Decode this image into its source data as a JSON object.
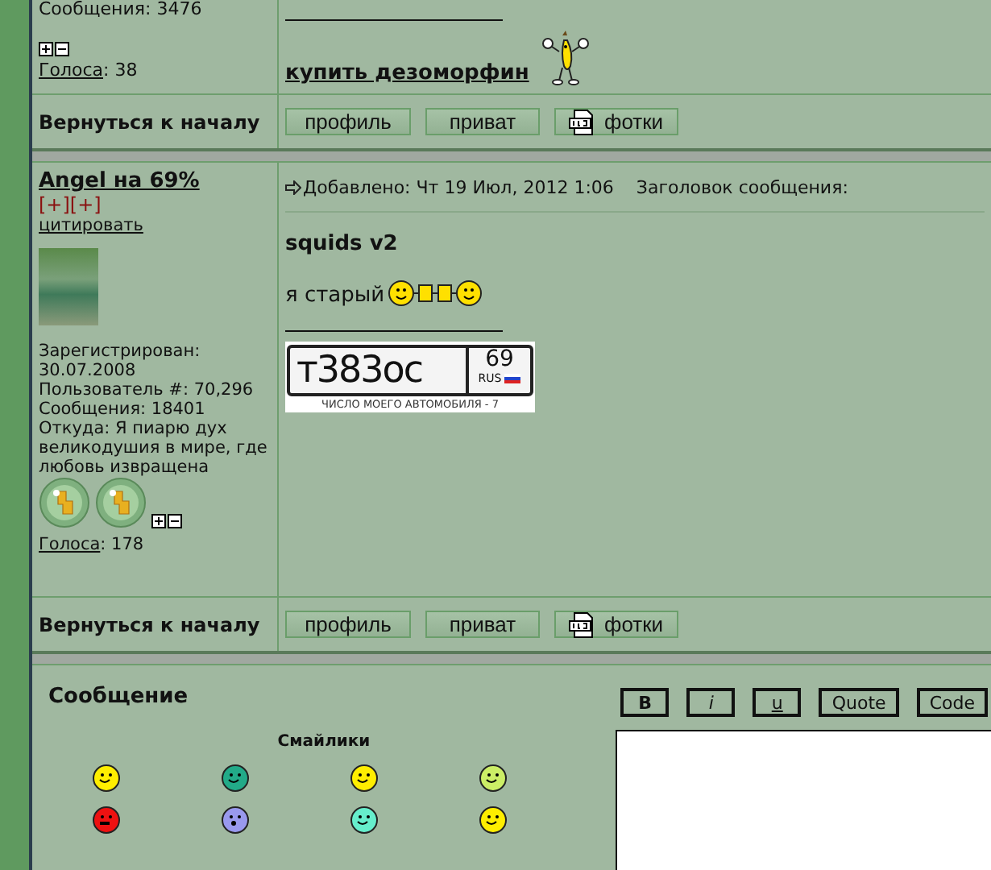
{
  "posts": [
    {
      "author": {
        "stats": [
          "Сообщения: 3476"
        ],
        "votes_label": "Голоса",
        "votes_count": ": 38"
      },
      "signature": {
        "kind": "link",
        "text": "купить дезоморфин"
      },
      "nav": {
        "back": "Вернуться к началу",
        "buttons": [
          "профиль",
          "приват",
          "фотки"
        ]
      }
    },
    {
      "author": {
        "name": "Angel на 69%",
        "karma": "[+][+]",
        "quote": "цитировать",
        "stats": [
          "Зарегистрирован:",
          "30.07.2008",
          "Пользователь #: 70,296",
          "Сообщения: 18401",
          "Откуда: Я пиарю дух великодушия в мире, где любовь извращена"
        ],
        "medals": [
          {
            "kind": "medal"
          },
          {
            "kind": "medal"
          }
        ],
        "votes_label": "Голоса",
        "votes_count": ": 178"
      },
      "header": {
        "posted": "Добавлено: Чт 19 Июл, 2012 1:06",
        "subject_label": "Заголовок сообщения:"
      },
      "title": "squids v2",
      "text": "я старый",
      "signature": {
        "kind": "plate",
        "number": "т383ос",
        "region": "69",
        "country": "RUS",
        "caption": "ЧИСЛО МОЕГО АВТОМОБИЛЯ - 7"
      },
      "nav": {
        "back": "Вернуться к началу",
        "buttons": [
          "профиль",
          "приват",
          "фотки"
        ]
      }
    }
  ],
  "reply_form": {
    "label": "Сообщение",
    "smilies_label": "Смайлики",
    "smilies": [
      {
        "color": "#ffee00"
      },
      {
        "color": "#22aa88"
      },
      {
        "color": "#ffee00"
      },
      {
        "color": "#ccee66"
      },
      {
        "color": "#ee1111"
      },
      {
        "color": "#9999ee"
      },
      {
        "color": "#66eecc"
      },
      {
        "color": "#ffee00"
      }
    ],
    "format_buttons": [
      {
        "label": "B",
        "kind": "bold"
      },
      {
        "label": "i",
        "kind": "italic"
      },
      {
        "label": "u",
        "kind": "underline"
      },
      {
        "label": "Quote",
        "kind": "plain"
      },
      {
        "label": "Code",
        "kind": "plain"
      }
    ]
  }
}
